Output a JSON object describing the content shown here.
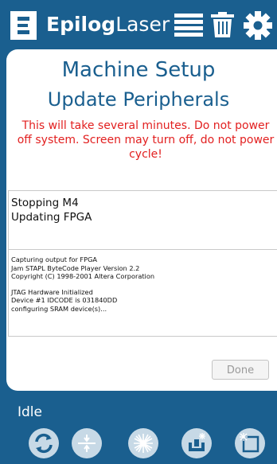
{
  "header": {
    "brand_bold": "Epilog",
    "brand_light": "Laser",
    "icons": [
      "menu-icon",
      "trash-icon",
      "gear-icon"
    ]
  },
  "main": {
    "title": "Machine Setup",
    "subtitle": "Update Peripherals",
    "warning": "This will take several minutes. Do not power off system. Screen may turn off, do not power cycle!",
    "status_lines": [
      "Stopping M4",
      "Updating FPGA"
    ],
    "log_lines": [
      "Capturing output for FPGA",
      "Jam STAPL ByteCode Player Version 2.2",
      "Copyright (C) 1998-2001 Altera Corporation",
      "",
      "JTAG Hardware Initialized",
      "Device #1 IDCODE is 031840DD",
      "configuring SRAM device(s)..."
    ],
    "done_label": "Done"
  },
  "footer": {
    "status": "Idle",
    "tools": [
      "refresh-icon",
      "focus-icon",
      "laser-icon",
      "job-icon",
      "frame-icon"
    ]
  },
  "colors": {
    "brand_blue": "#1a5f8f",
    "warning_red": "#e21f1f",
    "tool_bg": "#c7d9e6"
  }
}
